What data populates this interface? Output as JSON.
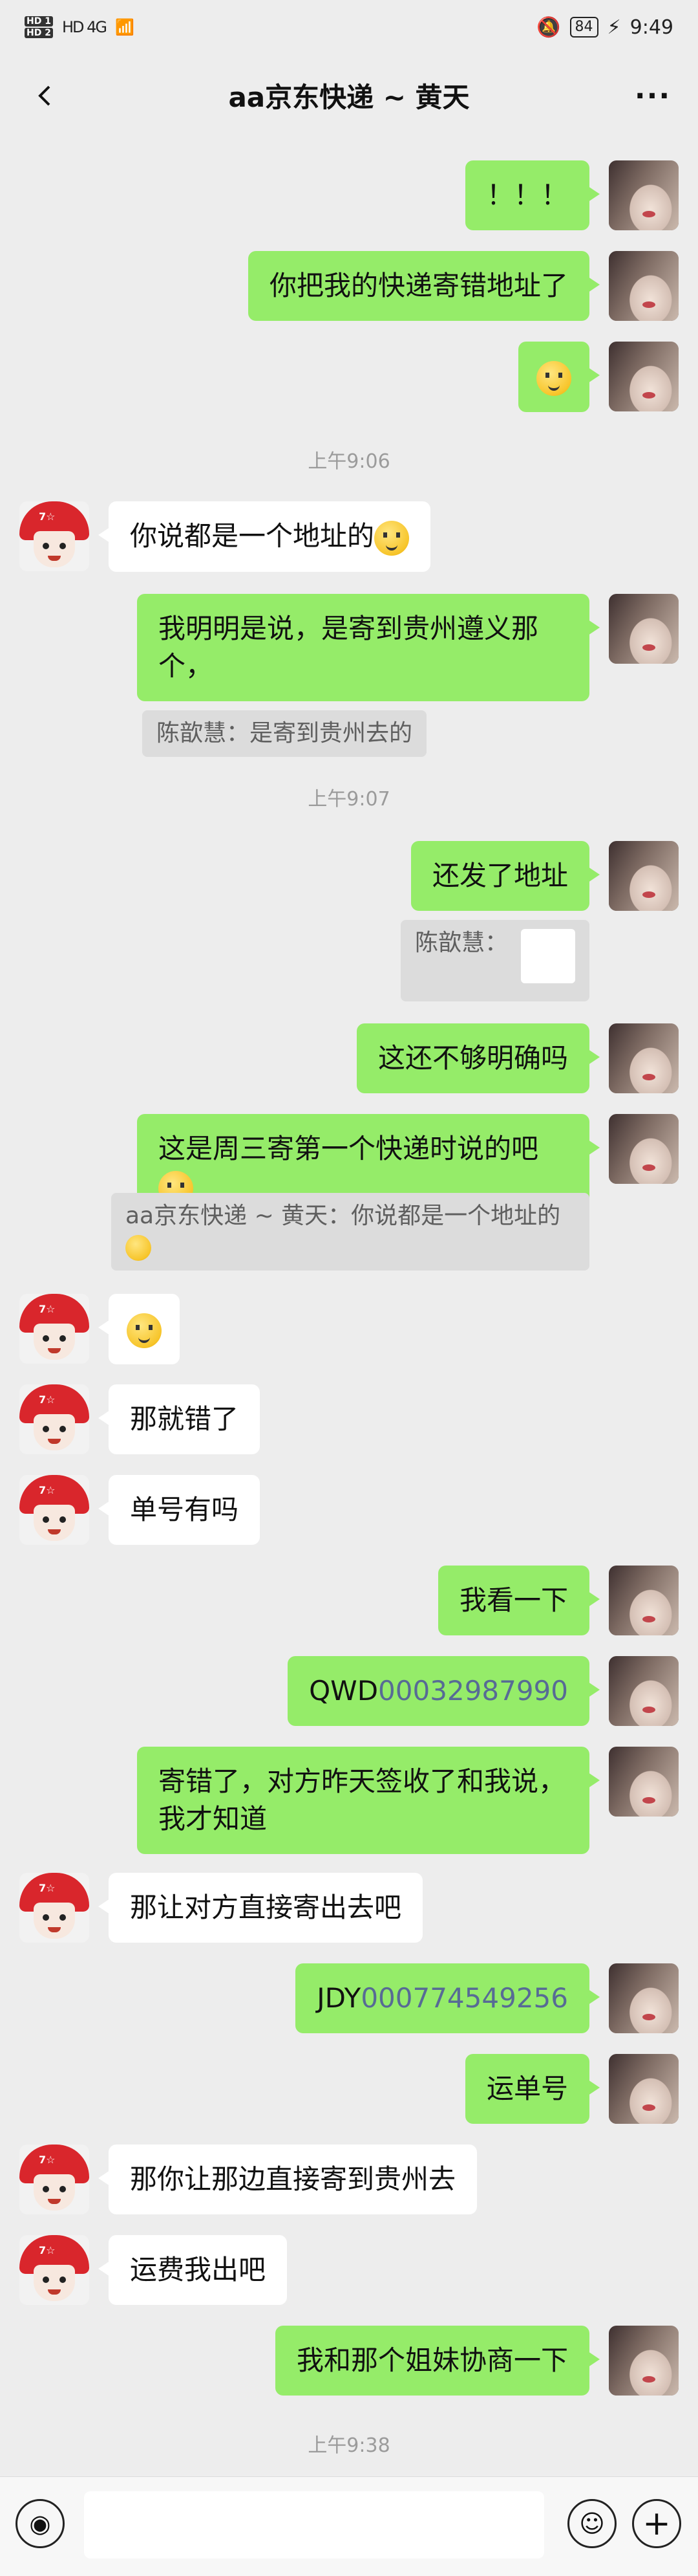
{
  "status_bar": {
    "network_left": "HD 4G",
    "time": "9:49",
    "battery": "84"
  },
  "header": {
    "title": "aa京东快递 ~ 黄天",
    "more_label": "···"
  },
  "messages": [
    {
      "from": "me",
      "text": "！！！"
    },
    {
      "from": "me",
      "text": "你把我的快递寄错地址了"
    },
    {
      "from": "me",
      "emoji": "awkward-smile-emoji"
    },
    {
      "time": "上午9:06"
    },
    {
      "from": "them",
      "text": "你说都是一个地址的"
    },
    {
      "from": "me",
      "text": "我明明是说，是寄到贵州遵义那个，",
      "quote": "陈歆慧：是寄到贵州去的"
    },
    {
      "time": "上午9:07"
    },
    {
      "from": "me",
      "text": "还发了地址",
      "quote": "陈歆慧："
    },
    {
      "from": "me",
      "text": "这还不够明确吗"
    },
    {
      "from": "me",
      "text": "这是周三寄第一个快递时说的吧",
      "quote": "aa京东快递 ~ 黄天：你说都是一个地址的"
    },
    {
      "from": "them",
      "emoji": "laugh-cry-emoji"
    },
    {
      "from": "them",
      "text": "那就错了"
    },
    {
      "from": "them",
      "text": "单号有吗"
    },
    {
      "from": "me",
      "text": "我看一下"
    },
    {
      "from": "me",
      "prefix": "QWD",
      "link": "00032987990"
    },
    {
      "from": "me",
      "text": "寄错了，对方昨天签收了和我说，我才知道"
    },
    {
      "from": "them",
      "text": "那让对方直接寄出去吧"
    },
    {
      "from": "me",
      "prefix": "JDY",
      "link": "000774549256"
    },
    {
      "from": "me",
      "text": "运单号"
    },
    {
      "from": "them",
      "text": "那你让那边直接寄到贵州去"
    },
    {
      "from": "them",
      "text": "运费我出吧"
    },
    {
      "from": "me",
      "text": "我和那个姐妹协商一下"
    },
    {
      "time": "上午9:38"
    }
  ],
  "colors": {
    "me_bubble": "#95ec69",
    "them_bubble": "#ffffff",
    "background": "#ededed",
    "link": "#576b95"
  }
}
